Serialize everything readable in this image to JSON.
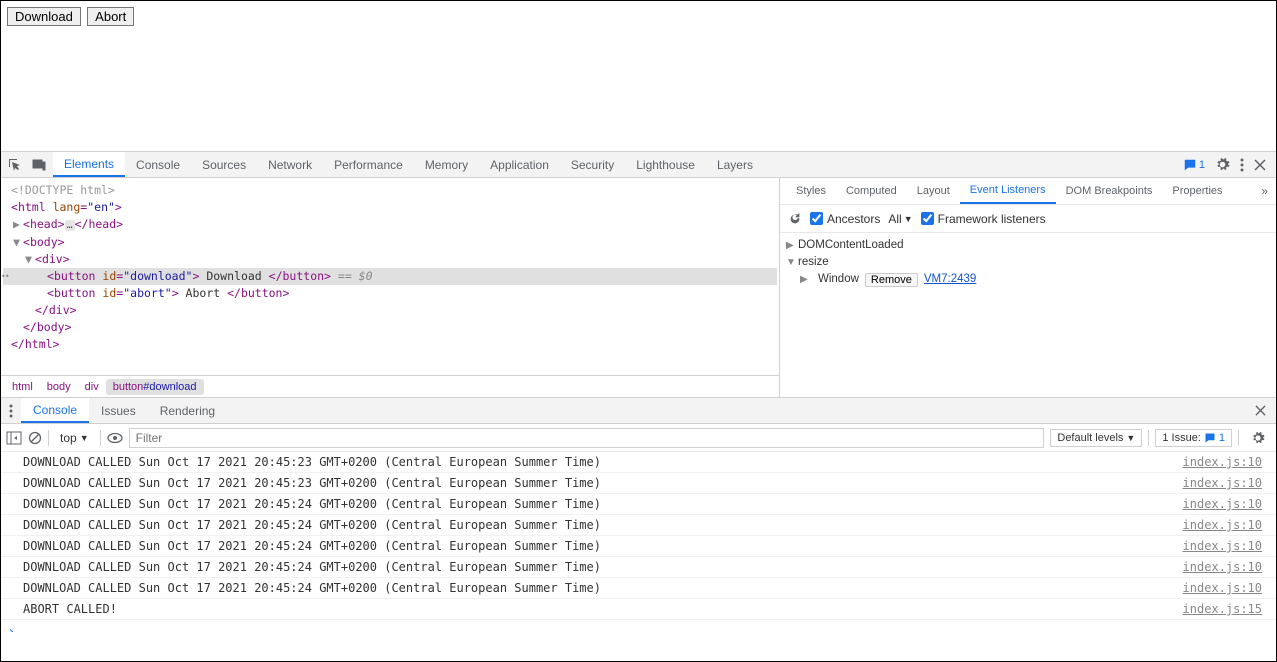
{
  "page": {
    "download_label": "Download",
    "abort_label": "Abort"
  },
  "devtools_tabs": {
    "elements": "Elements",
    "console": "Console",
    "sources": "Sources",
    "network": "Network",
    "performance": "Performance",
    "memory": "Memory",
    "application": "Application",
    "security": "Security",
    "lighthouse": "Lighthouse",
    "layers": "Layers"
  },
  "header_badge_count": "1",
  "dom": {
    "doctype": "<!DOCTYPE html>",
    "html_open_tag": "html",
    "html_attr_name": "lang",
    "html_attr_val": "\"en\"",
    "head_tag": "head",
    "head_ellipsis": "…",
    "head_close": "</head>",
    "body_tag": "body",
    "div_tag": "div",
    "button_tag": "button",
    "id_attr": "id",
    "download_id": "\"download\"",
    "download_text": " Download ",
    "button_close": "</button>",
    "eq_dollar": " == $0",
    "abort_id": "\"abort\"",
    "abort_text": " Abort ",
    "div_close": "</div>",
    "body_close": "</body>",
    "html_close": "</html>"
  },
  "breadcrumb": {
    "html": "html",
    "body": "body",
    "div": "div",
    "button_tag": "button",
    "button_id": "#download"
  },
  "sidebar_tabs": {
    "styles": "Styles",
    "computed": "Computed",
    "layout": "Layout",
    "listeners": "Event Listeners",
    "dom_breakpoints": "DOM Breakpoints",
    "properties": "Properties"
  },
  "listeners_toolbar": {
    "ancestors": "Ancestors",
    "scope": "All",
    "framework": "Framework listeners"
  },
  "listeners": {
    "event1": "DOMContentLoaded",
    "event2": "resize",
    "target": "Window",
    "remove_label": "Remove",
    "src_link": "VM7:2439"
  },
  "drawer_tabs": {
    "console": "Console",
    "issues": "Issues",
    "rendering": "Rendering"
  },
  "console_toolbar": {
    "context": "top",
    "filter_placeholder": "Filter",
    "levels": "Default levels",
    "issues_label": "1 Issue:",
    "issues_count": "1"
  },
  "console_logs": [
    {
      "msg": "DOWNLOAD CALLED Sun Oct 17 2021 20:45:23 GMT+0200 (Central European Summer Time)",
      "src": "index.js:10"
    },
    {
      "msg": "DOWNLOAD CALLED Sun Oct 17 2021 20:45:23 GMT+0200 (Central European Summer Time)",
      "src": "index.js:10"
    },
    {
      "msg": "DOWNLOAD CALLED Sun Oct 17 2021 20:45:24 GMT+0200 (Central European Summer Time)",
      "src": "index.js:10"
    },
    {
      "msg": "DOWNLOAD CALLED Sun Oct 17 2021 20:45:24 GMT+0200 (Central European Summer Time)",
      "src": "index.js:10"
    },
    {
      "msg": "DOWNLOAD CALLED Sun Oct 17 2021 20:45:24 GMT+0200 (Central European Summer Time)",
      "src": "index.js:10"
    },
    {
      "msg": "DOWNLOAD CALLED Sun Oct 17 2021 20:45:24 GMT+0200 (Central European Summer Time)",
      "src": "index.js:10"
    },
    {
      "msg": "DOWNLOAD CALLED Sun Oct 17 2021 20:45:24 GMT+0200 (Central European Summer Time)",
      "src": "index.js:10"
    },
    {
      "msg": "ABORT CALLED!",
      "src": "index.js:15"
    }
  ]
}
